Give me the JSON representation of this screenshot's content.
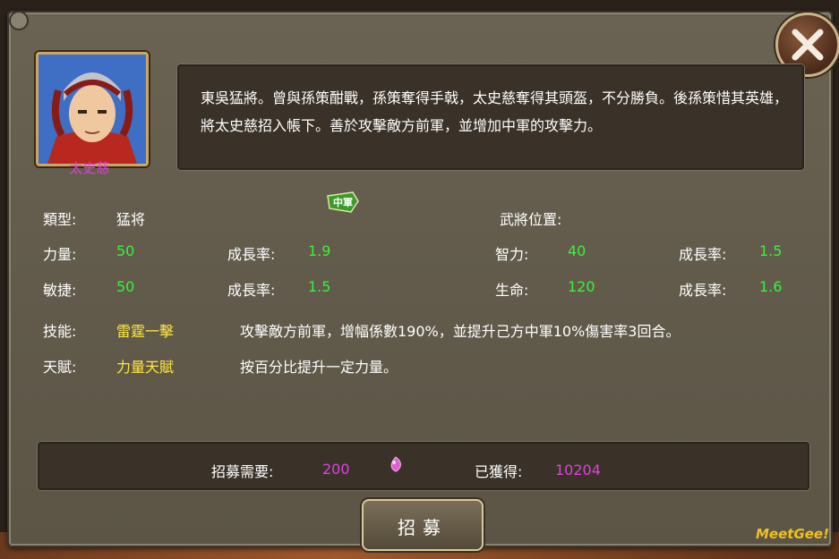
{
  "hero": {
    "name": "太史慈",
    "description": "東吳猛將。曾與孫策酣戰，孫策奪得手戟，太史慈奪得其頭盔，不分勝負。後孫策惜其英雄，將太史慈招入帳下。善於攻擊敵方前軍，並增加中軍的攻擊力。"
  },
  "stats": {
    "type_label": "類型:",
    "type_value": "猛将",
    "position_label": "武將位置:",
    "position_badge": "中軍",
    "strength_label": "力量:",
    "strength_value": "50",
    "strength_growth_label": "成長率:",
    "strength_growth_value": "1.9",
    "intellect_label": "智力:",
    "intellect_value": "40",
    "intellect_growth_label": "成長率:",
    "intellect_growth_value": "1.5",
    "agility_label": "敏捷:",
    "agility_value": "50",
    "agility_growth_label": "成長率:",
    "agility_growth_value": "1.5",
    "life_label": "生命:",
    "life_value": "120",
    "life_growth_label": "成長率:",
    "life_growth_value": "1.6"
  },
  "skill": {
    "label": "技能:",
    "name": "雷霆一擊",
    "description": "攻擊敵方前軍，增幅係數190%，並提升己方中軍10%傷害率3回合。"
  },
  "talent": {
    "label": "天賦:",
    "name": "力量天賦",
    "description": "按百分比提升一定力量。"
  },
  "recruit": {
    "need_label": "招募需要:",
    "need_value": "200",
    "owned_label": "已獲得:",
    "owned_value": "10204",
    "button_label": "招募",
    "currency_icon": "pink-gem-icon"
  },
  "branding": {
    "logo": "MeetGee!"
  },
  "colors": {
    "green_value": "#3cf03c",
    "yellow_value": "#ffe83c",
    "magenta_value": "#e040e0"
  }
}
